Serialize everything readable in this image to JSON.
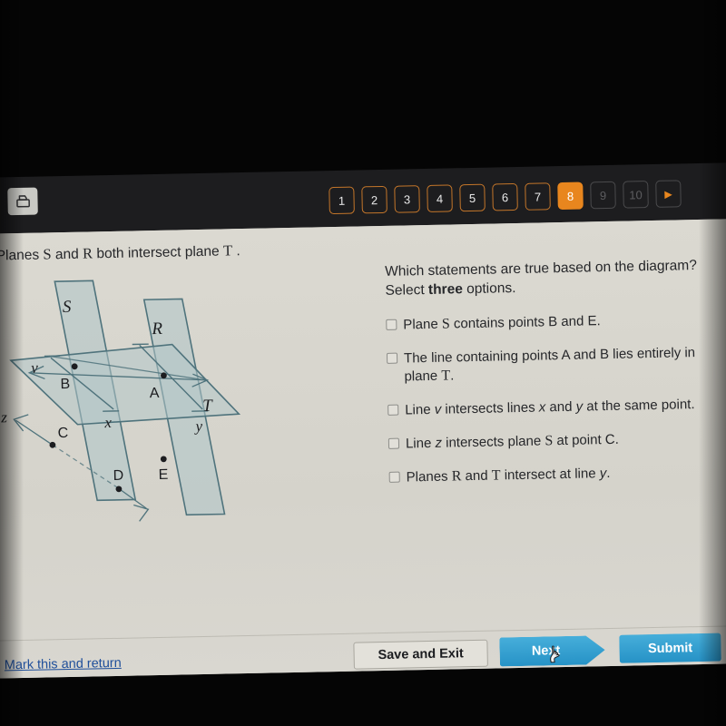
{
  "topbar": {
    "print_icon": "printer-icon",
    "pages": [
      {
        "label": "1",
        "state": "available"
      },
      {
        "label": "2",
        "state": "available"
      },
      {
        "label": "3",
        "state": "available"
      },
      {
        "label": "4",
        "state": "available"
      },
      {
        "label": "5",
        "state": "available"
      },
      {
        "label": "6",
        "state": "available"
      },
      {
        "label": "7",
        "state": "available"
      },
      {
        "label": "8",
        "state": "active"
      },
      {
        "label": "9",
        "state": "disabled"
      },
      {
        "label": "10",
        "state": "disabled"
      }
    ],
    "next_page_arrow": "▶",
    "active_page": "8",
    "accent_color": "#e8861e"
  },
  "prompt": {
    "text_before": "Planes ",
    "plane_s": "S",
    "text_mid": " and ",
    "plane_r": "R",
    "text_after": " both intersect plane ",
    "plane_t": "T",
    "period": " ."
  },
  "question": {
    "stem_line1": "Which statements are true based on the diagram?",
    "stem_line2_before": "Select ",
    "stem_line2_bold": "three",
    "stem_line2_after": " options.",
    "choices": [
      {
        "id": "choice-1",
        "checked": false,
        "parts": [
          {
            "t": "Plane ",
            "style": "plain"
          },
          {
            "t": "S",
            "style": "serif"
          },
          {
            "t": " contains points B and E.",
            "style": "plain"
          }
        ]
      },
      {
        "id": "choice-2",
        "checked": false,
        "parts": [
          {
            "t": "The line containing points A and B lies entirely in plane ",
            "style": "plain"
          },
          {
            "t": "T",
            "style": "serif"
          },
          {
            "t": ".",
            "style": "plain"
          }
        ]
      },
      {
        "id": "choice-3",
        "checked": false,
        "parts": [
          {
            "t": "Line ",
            "style": "plain"
          },
          {
            "t": "v",
            "style": "italic"
          },
          {
            "t": " intersects lines ",
            "style": "plain"
          },
          {
            "t": "x",
            "style": "italic"
          },
          {
            "t": " and ",
            "style": "plain"
          },
          {
            "t": "y",
            "style": "italic"
          },
          {
            "t": " at the same point.",
            "style": "plain"
          }
        ]
      },
      {
        "id": "choice-4",
        "checked": false,
        "parts": [
          {
            "t": "Line ",
            "style": "plain"
          },
          {
            "t": "z",
            "style": "italic"
          },
          {
            "t": " intersects plane ",
            "style": "plain"
          },
          {
            "t": "S",
            "style": "serif"
          },
          {
            "t": " at point C.",
            "style": "plain"
          }
        ]
      },
      {
        "id": "choice-5",
        "checked": false,
        "parts": [
          {
            "t": "Planes ",
            "style": "plain"
          },
          {
            "t": "R",
            "style": "serif"
          },
          {
            "t": " and ",
            "style": "plain"
          },
          {
            "t": "T",
            "style": "serif"
          },
          {
            "t": " intersect at line ",
            "style": "plain"
          },
          {
            "t": "y",
            "style": "italic"
          },
          {
            "t": ".",
            "style": "plain"
          }
        ]
      }
    ]
  },
  "figure": {
    "description": "Three intersecting planes S, R and T with labeled points and lines",
    "plane_labels": [
      "S",
      "R",
      "T"
    ],
    "point_labels": [
      "B",
      "A",
      "C",
      "D",
      "E"
    ],
    "line_labels": [
      "v",
      "x",
      "y",
      "z"
    ],
    "stroke_color": "#4f737c",
    "fill_color": "#b9cbcb"
  },
  "actions": {
    "mark_and_return": "Mark this and return",
    "save_and_exit": "Save and Exit",
    "next": "Next",
    "submit": "Submit",
    "button_color": "#2e9fd0",
    "link_color": "#1f4f9b",
    "cursor": "hand-pointer-cursor"
  }
}
